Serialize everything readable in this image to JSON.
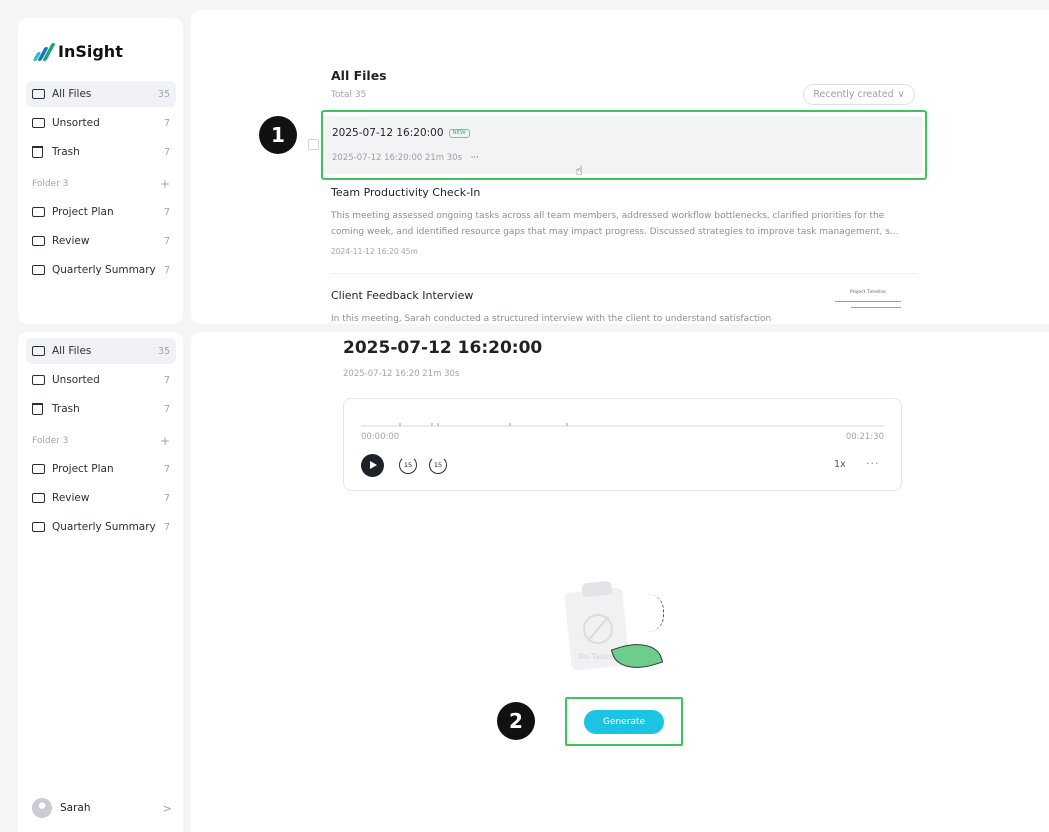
{
  "app": {
    "name": "InSight"
  },
  "sidebar": {
    "items": [
      {
        "label": "All Files",
        "count": "35"
      },
      {
        "label": "Unsorted",
        "count": "7"
      },
      {
        "label": "Trash",
        "count": "7"
      }
    ],
    "folder_header": "Folder 3",
    "folder_add": "+",
    "folders": [
      {
        "label": "Project Plan",
        "count": "7"
      },
      {
        "label": "Review",
        "count": "7"
      },
      {
        "label": "Quarterly Summary",
        "count": "7"
      }
    ],
    "user": {
      "name": "Sarah",
      "chevron": ">"
    }
  },
  "list": {
    "title": "All Files",
    "total": "Total 35",
    "sort": {
      "label": "Recently created",
      "chevron": "∨"
    },
    "items": [
      {
        "title": "2025-07-12 16:20:00",
        "badge": "NEW",
        "meta": "2025-07-12 16:20:00   21m 30s",
        "more": "···"
      },
      {
        "title": "Team Productivity Check-In",
        "summary": "This meeting assessed ongoing tasks across all team members, addressed workflow bottlenecks, clarified priorities for the coming week, and identified resource gaps that may impact progress. Discussed strategies to improve task management, s...",
        "meta": "2024-11-12 16:20   45m"
      },
      {
        "title": "Client Feedback Interview",
        "summary": "In this meeting, Sarah conducted a structured interview with the client to understand satisfaction",
        "thumb_title": "Project Timeline"
      }
    ]
  },
  "callouts": [
    "1",
    "2"
  ],
  "recording": {
    "title": "2025-07-12 16:20:00",
    "meta": "2025-07-12 16:20   21m 30s",
    "time_start": "00:00:00",
    "time_end": "00:21:30",
    "skip_back": "15",
    "skip_fwd": "15",
    "speed": "1x",
    "more": "···"
  },
  "empty_state": {
    "text": "No Tasks"
  },
  "generate_button": "Generate",
  "icons": {
    "folder": "folder-icon",
    "trash": "trash-icon",
    "play": "play-icon",
    "skip_back": "skip-back-15-icon",
    "skip_fwd": "skip-forward-15-icon",
    "cursor": "hand-pointer-icon",
    "leaf": "leaf-icon",
    "clipboard": "clipboard-icon"
  },
  "colors": {
    "highlight": "#3ec35d",
    "generate": "#1cc4e4",
    "new_badge": "#2ab77a"
  }
}
